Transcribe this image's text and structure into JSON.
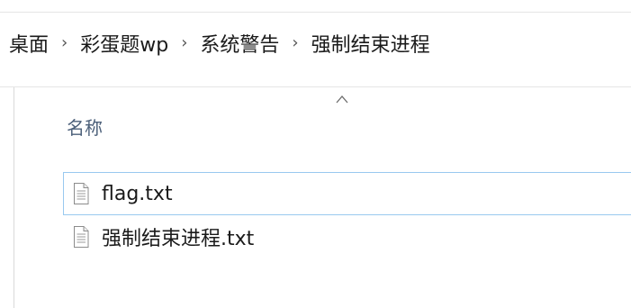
{
  "breadcrumb": {
    "items": [
      "桌面",
      "彩蛋题wp",
      "系统警告",
      "强制结束进程"
    ],
    "separator": "›"
  },
  "list": {
    "column_header": "名称",
    "sort_icon": "chevron-up-icon",
    "files": [
      {
        "name": "flag.txt",
        "icon": "text-file-icon",
        "focused": true
      },
      {
        "name": "强制结束进程.txt",
        "icon": "text-file-icon",
        "focused": false
      }
    ]
  },
  "colors": {
    "focus_border": "#99c9ef",
    "header_text": "#4c607a"
  }
}
